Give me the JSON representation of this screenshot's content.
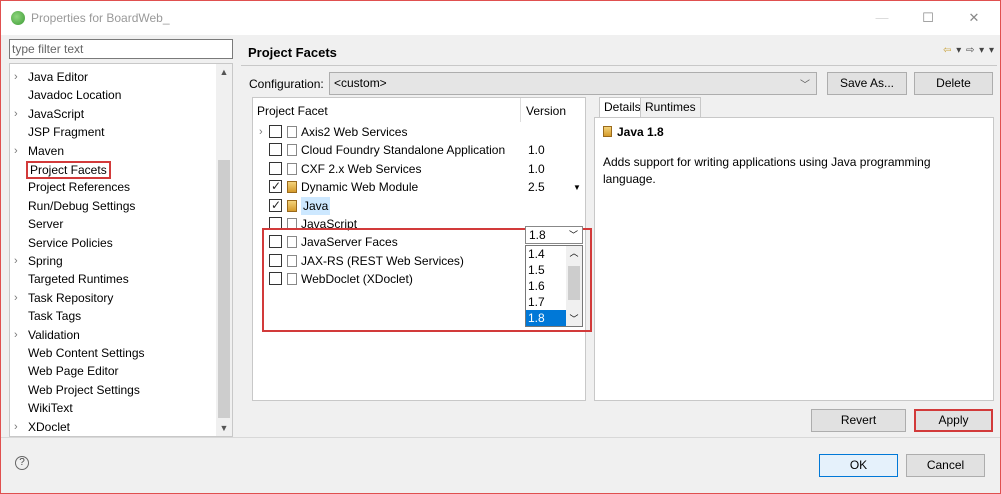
{
  "window": {
    "title": "Properties for BoardWeb_"
  },
  "filter": {
    "placeholder": "type filter text"
  },
  "tree_items": [
    {
      "label": "Java Editor",
      "arrow": true
    },
    {
      "label": "Javadoc Location",
      "arrow": false
    },
    {
      "label": "JavaScript",
      "arrow": true
    },
    {
      "label": "JSP Fragment",
      "arrow": false
    },
    {
      "label": "Maven",
      "arrow": true
    },
    {
      "label": "Project Facets",
      "arrow": false,
      "selected": true
    },
    {
      "label": "Project References",
      "arrow": false
    },
    {
      "label": "Run/Debug Settings",
      "arrow": false
    },
    {
      "label": "Server",
      "arrow": false
    },
    {
      "label": "Service Policies",
      "arrow": false
    },
    {
      "label": "Spring",
      "arrow": true
    },
    {
      "label": "Targeted Runtimes",
      "arrow": false
    },
    {
      "label": "Task Repository",
      "arrow": true
    },
    {
      "label": "Task Tags",
      "arrow": false
    },
    {
      "label": "Validation",
      "arrow": true
    },
    {
      "label": "Web Content Settings",
      "arrow": false
    },
    {
      "label": "Web Page Editor",
      "arrow": false
    },
    {
      "label": "Web Project Settings",
      "arrow": false
    },
    {
      "label": "WikiText",
      "arrow": false
    },
    {
      "label": "XDoclet",
      "arrow": true
    }
  ],
  "header": {
    "title": "Project Facets"
  },
  "config": {
    "label": "Configuration:",
    "value": "<custom>",
    "save_as": "Save As...",
    "delete": "Delete"
  },
  "table": {
    "col_facet": "Project Facet",
    "col_version": "Version"
  },
  "facets": [
    {
      "name": "Axis2 Web Services",
      "version": "",
      "checked": false,
      "arrow": true
    },
    {
      "name": "Cloud Foundry Standalone Application",
      "version": "1.0",
      "checked": false
    },
    {
      "name": "CXF 2.x Web Services",
      "version": "1.0",
      "checked": false
    },
    {
      "name": "Dynamic Web Module",
      "version": "2.5",
      "checked": true,
      "caret": true
    },
    {
      "name": "Java",
      "version": "",
      "checked": true,
      "highlight": true
    },
    {
      "name": "JavaScript",
      "version": "",
      "checked": false
    },
    {
      "name": "JavaServer Faces",
      "version": "",
      "checked": false
    },
    {
      "name": "JAX-RS (REST Web Services)",
      "version": "",
      "checked": false
    },
    {
      "name": "WebDoclet (XDoclet)",
      "version": "",
      "checked": false
    }
  ],
  "version_dropdown": {
    "selected": "1.8",
    "options": [
      "1.4",
      "1.5",
      "1.6",
      "1.7",
      "1.8"
    ]
  },
  "details": {
    "tab_details": "Details",
    "tab_runtimes": "Runtimes",
    "title": "Java 1.8",
    "description": "Adds support for writing applications using Java programming language."
  },
  "actions": {
    "revert": "Revert",
    "apply": "Apply"
  },
  "footer": {
    "ok": "OK",
    "cancel": "Cancel",
    "help": "?"
  },
  "colors": {
    "accent_red": "#d23a3a",
    "selection_blue": "#0078d7"
  }
}
